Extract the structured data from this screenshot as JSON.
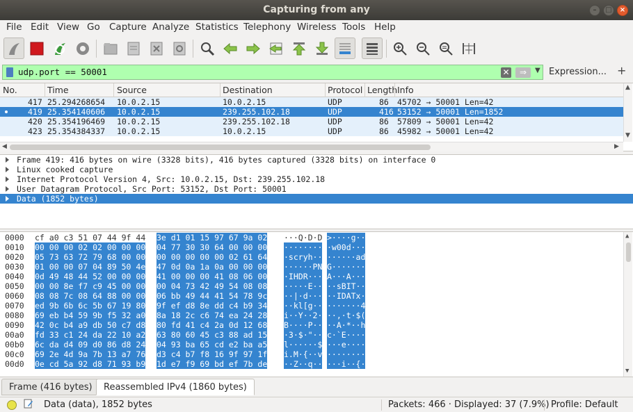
{
  "window": {
    "title": "Capturing from any"
  },
  "menu": [
    "File",
    "Edit",
    "View",
    "Go",
    "Capture",
    "Analyze",
    "Statistics",
    "Telephony",
    "Wireless",
    "Tools",
    "Help"
  ],
  "toolbar": {
    "icons": [
      "shark-fin-start-icon",
      "stop-capture-icon",
      "restart-capture-icon",
      "capture-options-icon",
      "open-file-icon",
      "save-file-icon",
      "close-file-icon",
      "reload-file-icon",
      "find-packet-icon",
      "go-back-icon",
      "go-forward-icon",
      "go-to-packet-icon",
      "go-first-packet-icon",
      "go-last-packet-icon",
      "autoscroll-icon",
      "colorize-icon",
      "zoom-in-icon",
      "zoom-out-icon",
      "normal-size-icon",
      "resize-columns-icon"
    ]
  },
  "filter": {
    "value": "udp.port == 50001",
    "expression_label": "Expression...",
    "add_label": "+",
    "colors": {
      "valid_bg": "#afffaf"
    }
  },
  "packet_list": {
    "columns": [
      "No.",
      "Time",
      "Source",
      "Destination",
      "Protocol",
      "Length",
      "Info"
    ],
    "rows": [
      {
        "no": "417",
        "time": "25.294268654",
        "src": "10.0.2.15",
        "dst": "10.0.2.15",
        "proto": "UDP",
        "len": "86",
        "info": "45702 → 50001 Len=42"
      },
      {
        "no": "419",
        "time": "25.354140606",
        "src": "10.0.2.15",
        "dst": "239.255.102.18",
        "proto": "UDP",
        "len": "416",
        "info": "53152 → 50001 Len=1852"
      },
      {
        "no": "420",
        "time": "25.354196469",
        "src": "10.0.2.15",
        "dst": "239.255.102.18",
        "proto": "UDP",
        "len": "86",
        "info": "57809 → 50001 Len=42"
      },
      {
        "no": "423",
        "time": "25.354384337",
        "src": "10.0.2.15",
        "dst": "10.0.2.15",
        "proto": "UDP",
        "len": "86",
        "info": "45982 → 50001 Len=42"
      }
    ],
    "selected_index": 1
  },
  "details": [
    "Frame 419: 416 bytes on wire (3328 bits), 416 bytes captured (3328 bits) on interface 0",
    "Linux cooked capture",
    "Internet Protocol Version 4, Src: 10.0.2.15, Dst: 239.255.102.18",
    "User Datagram Protocol, Src Port: 53152, Dst Port: 50001",
    "Data (1852 bytes)"
  ],
  "bytes": {
    "rows": [
      {
        "off": "0000",
        "hex_a": "cf a0 c3 51 07 44 9f 44",
        "hex_b": "3e d1 01 15 97 67 9a 02",
        "asc_a": "···Q·D·D",
        "asc_b": ">····g··"
      },
      {
        "off": "0010",
        "hex_a": "00 00 00 02 02 00 00 00",
        "hex_b": "04 77 30 30 64 00 00 00",
        "asc_a": "········",
        "asc_b": "·w00d···"
      },
      {
        "off": "0020",
        "hex_a": "05 73 63 72 79 68 00 00",
        "hex_b": "00 00 00 00 00 02 61 64",
        "asc_a": "·scryh··",
        "asc_b": "······ad"
      },
      {
        "off": "0030",
        "hex_a": "01 00 00 07 04 89 50 4e",
        "hex_b": "47 0d 0a 1a 0a 00 00 00",
        "asc_a": "······PN",
        "asc_b": "G·······"
      },
      {
        "off": "0040",
        "hex_a": "0d 49 48 44 52 00 00 00",
        "hex_b": "41 00 00 00 41 08 06 00",
        "asc_a": "·IHDR···",
        "asc_b": "A···A···"
      },
      {
        "off": "0050",
        "hex_a": "00 00 8e f7 c9 45 00 00",
        "hex_b": "00 04 73 42 49 54 08 08",
        "asc_a": "·····E··",
        "asc_b": "··sBIT··"
      },
      {
        "off": "0060",
        "hex_a": "08 08 7c 08 64 88 00 00",
        "hex_b": "06 bb 49 44 41 54 78 9c",
        "asc_a": "··|·d···",
        "asc_b": "··IDATx·"
      },
      {
        "off": "0070",
        "hex_a": "ed 9b 6b 6c 5b 67 19 80",
        "hex_b": "9f ef d8 8e dd c4 b9 34",
        "asc_a": "··kl[g··",
        "asc_b": "·······4"
      },
      {
        "off": "0080",
        "hex_a": "69 eb b4 59 9b f5 32 a0",
        "hex_b": "8a 18 2c c6 74 ea 24 28",
        "asc_a": "i··Y··2·",
        "asc_b": "··,·t·$("
      },
      {
        "off": "0090",
        "hex_a": "42 0c b4 a9 db 50 c7 d8",
        "hex_b": "80 fd 41 c4 2a 0d 12 68",
        "asc_a": "B····P··",
        "asc_b": "··A·*··h"
      },
      {
        "off": "00a0",
        "hex_a": "fd 33 c1 24 da 22 10 a2",
        "hex_b": "63 80 60 45 c3 88 ad 15",
        "asc_a": "·3·$·\"··",
        "asc_b": "c·`E····"
      },
      {
        "off": "00b0",
        "hex_a": "6c da d4 09 d0 86 d8 24",
        "hex_b": "04 93 ba 65 cd e2 ba a5",
        "asc_a": "l······$",
        "asc_b": "···e····"
      },
      {
        "off": "00c0",
        "hex_a": "69 2e 4d 9a 7b 13 a7 76",
        "hex_b": "d3 c4 b7 f8 16 9f 97 1f",
        "asc_a": "i.M·{··v",
        "asc_b": "········"
      },
      {
        "off": "00d0",
        "hex_a": "0e cd 5a 92 d8 71 93 b9",
        "hex_b": "1d e7 f9 69 bd ef 7b de",
        "asc_a": "··Z··q··",
        "asc_b": "···i··{·"
      }
    ]
  },
  "tabs": [
    "Frame (416 bytes)",
    "Reassembled IPv4 (1860 bytes)"
  ],
  "status": {
    "field": "Data (data), 1852 bytes",
    "packets": "Packets: 466 · Displayed: 37 (7.9%)",
    "profile": "Profile: Default"
  },
  "colors": {
    "selection": "#3584cf",
    "row_bg": "#e4f0fb",
    "stop": "#d0191e"
  }
}
